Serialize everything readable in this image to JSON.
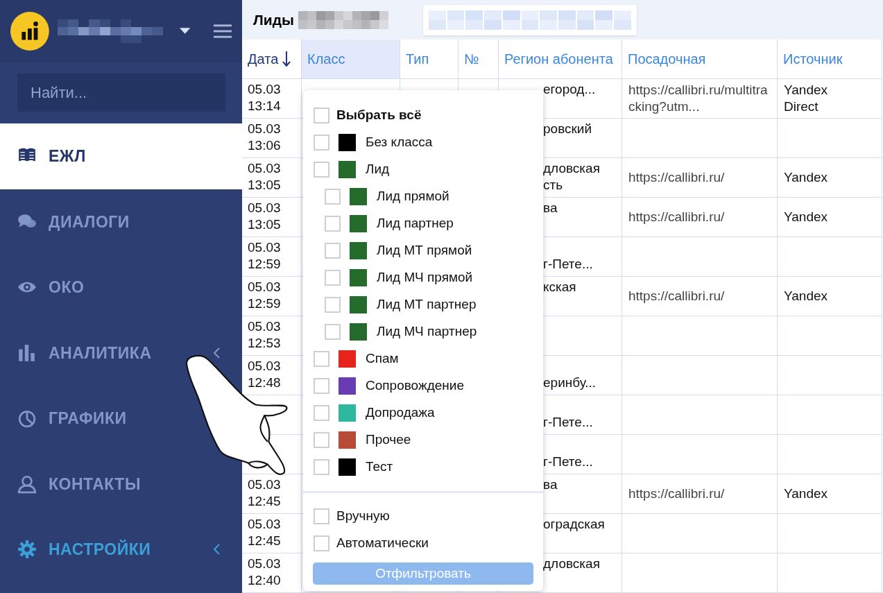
{
  "sidebar": {
    "search": {
      "placeholder": "Найти..."
    },
    "items": [
      {
        "label": "ЕЖЛ",
        "selected": true,
        "highlighted": false,
        "expandable": false
      },
      {
        "label": "ДИАЛОГИ",
        "selected": false,
        "highlighted": false,
        "expandable": false
      },
      {
        "label": "ОКО",
        "selected": false,
        "highlighted": false,
        "expandable": false
      },
      {
        "label": "АНАЛИТИКА",
        "selected": false,
        "highlighted": false,
        "expandable": true
      },
      {
        "label": "ГРАФИКИ",
        "selected": false,
        "highlighted": false,
        "expandable": false
      },
      {
        "label": "КОНТАКТЫ",
        "selected": false,
        "highlighted": false,
        "expandable": false
      },
      {
        "label": "НАСТРОЙКИ",
        "selected": false,
        "highlighted": true,
        "expandable": true
      }
    ]
  },
  "page_title": "Лиды",
  "table": {
    "columns": [
      {
        "label": "Дата",
        "sorted": true,
        "selected": false
      },
      {
        "label": "Класс",
        "sorted": false,
        "selected": true
      },
      {
        "label": "Тип",
        "sorted": false,
        "selected": false
      },
      {
        "label": "№",
        "sorted": false,
        "selected": false
      },
      {
        "label": "Регион абонента",
        "sorted": false,
        "selected": false
      },
      {
        "label": "Посадочная",
        "sorted": false,
        "selected": false
      },
      {
        "label": "Источник",
        "sorted": false,
        "selected": false
      }
    ],
    "rows": [
      {
        "date": "05.03",
        "time": "13:14",
        "region": "егород...",
        "landing": "https://callibri.ru/multitracking?utm...",
        "source": "Yandex Direct"
      },
      {
        "date": "05.03",
        "time": "13:06",
        "region": "ровский",
        "landing": "",
        "source": ""
      },
      {
        "date": "05.03",
        "time": "13:05",
        "region": "дловская\nсть",
        "landing": "https://callibri.ru/",
        "source": "Yandex"
      },
      {
        "date": "05.03",
        "time": "13:05",
        "region": "ва",
        "landing": "https://callibri.ru/",
        "source": "Yandex"
      },
      {
        "date": "05.03",
        "time": "12:59",
        "region": "\nг-Пете...",
        "landing": "",
        "source": ""
      },
      {
        "date": "05.03",
        "time": "12:59",
        "region": "кская",
        "landing": "https://callibri.ru/",
        "source": "Yandex"
      },
      {
        "date": "05.03",
        "time": "12:53",
        "region": "",
        "landing": "",
        "source": ""
      },
      {
        "date": "05.03",
        "time": "12:48",
        "region": "\nеринбу...",
        "landing": "",
        "source": ""
      },
      {
        "date": "",
        "time": "",
        "region": "\nг-Пете...",
        "landing": "",
        "source": ""
      },
      {
        "date": "",
        "time": "",
        "region": "\nг-Пете...",
        "landing": "",
        "source": ""
      },
      {
        "date": "05.03",
        "time": "12:45",
        "region": "ва",
        "landing": "https://callibri.ru/",
        "source": "Yandex"
      },
      {
        "date": "05.03",
        "time": "12:45",
        "region": "оградская",
        "landing": "",
        "source": ""
      },
      {
        "date": "05.03",
        "time": "12:40",
        "region": "дловская",
        "landing": "",
        "source": ""
      }
    ]
  },
  "class_filter": {
    "items": [
      {
        "kind": "all",
        "label": "Выбрать всё",
        "checked": false
      },
      {
        "kind": "class",
        "label": "Без класса",
        "color": "#000000",
        "checked": false
      },
      {
        "kind": "class",
        "label": "Лид",
        "color": "#256b2c",
        "checked": false,
        "children": [
          {
            "kind": "class",
            "label": "Лид прямой",
            "color": "#256b2c",
            "checked": false
          },
          {
            "kind": "class",
            "label": "Лид партнер",
            "color": "#256b2c",
            "checked": false
          },
          {
            "kind": "class",
            "label": "Лид МТ прямой",
            "color": "#256b2c",
            "checked": false
          },
          {
            "kind": "class",
            "label": "Лид МЧ прямой",
            "color": "#256b2c",
            "checked": false
          },
          {
            "kind": "class",
            "label": "Лид МТ партнер",
            "color": "#256b2c",
            "checked": false
          },
          {
            "kind": "class",
            "label": "Лид МЧ партнер",
            "color": "#256b2c",
            "checked": false
          }
        ]
      },
      {
        "kind": "class",
        "label": "Спам",
        "color": "#e8231c",
        "checked": false
      },
      {
        "kind": "class",
        "label": "Сопровождение",
        "color": "#6a3cb4",
        "checked": false
      },
      {
        "kind": "class",
        "label": "Допродажа",
        "color": "#2fb8a0",
        "checked": false
      },
      {
        "kind": "class",
        "label": "Прочее",
        "color": "#b84a38",
        "checked": false
      },
      {
        "kind": "class",
        "label": "Тест",
        "color": "#000000",
        "checked": false
      }
    ],
    "modes": [
      {
        "label": "Вручную",
        "checked": false
      },
      {
        "label": "Автоматически",
        "checked": false
      }
    ],
    "button": "Отфильтровать"
  }
}
